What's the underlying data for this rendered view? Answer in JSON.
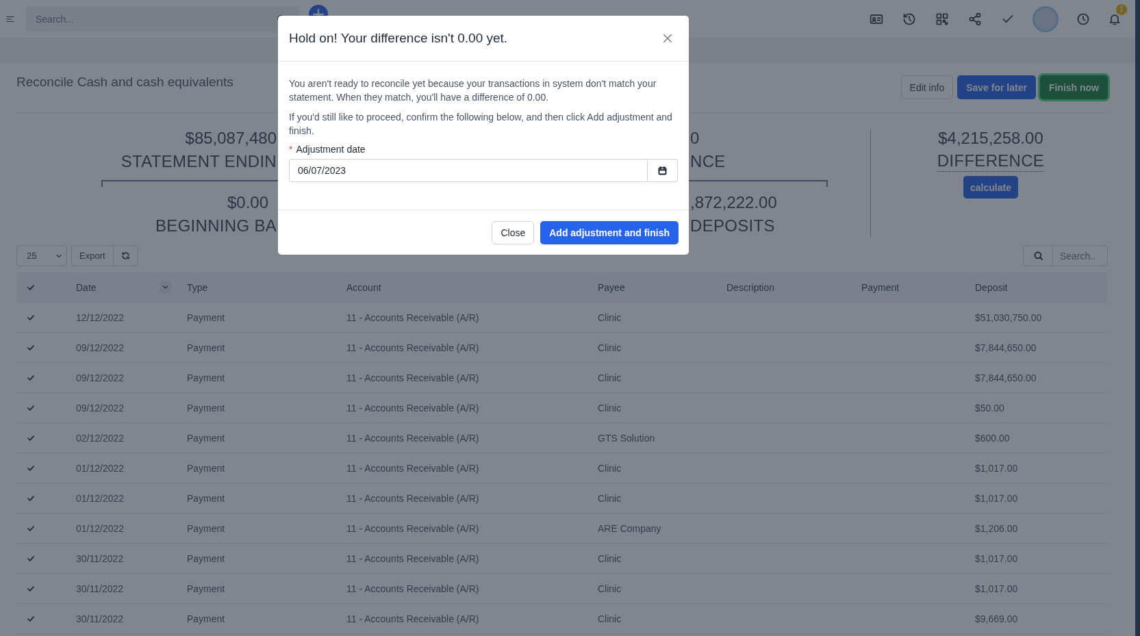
{
  "topbar": {
    "search_placeholder": "Search...",
    "notification_count": "1"
  },
  "page": {
    "title": "Reconcile Cash and cash equivalents",
    "actions": [
      {
        "label": "Edit info",
        "kind": "outline",
        "focused": false
      },
      {
        "label": "Save for later",
        "kind": "primary",
        "focused": false
      },
      {
        "label": "Finish now",
        "kind": "success",
        "focused": true
      }
    ]
  },
  "summary": {
    "left": [
      {
        "amount": "$85,087,480",
        "label": "STATEMENT ENDIN"
      },
      {
        "amount": "$0.00",
        "label": "BEGINNING BA"
      }
    ],
    "middle": [
      {
        "amount": "0",
        "label": "NCE"
      },
      {
        "amount": ",872,222.00",
        "label": "DEPOSITS"
      }
    ],
    "difference": {
      "amount": "$4,215,258.00",
      "label": "DIFFERENCE",
      "button": "calculate"
    }
  },
  "toolbar": {
    "page_size": "25",
    "export": "Export",
    "search_placeholder": "Search.."
  },
  "table": {
    "all_checked": true,
    "columns": [
      "Date",
      "Type",
      "Account",
      "Payee",
      "Description",
      "Payment",
      "Deposit"
    ],
    "rows": [
      {
        "checked": true,
        "date": "12/12/2022",
        "type": "Payment",
        "account": "11 - Accounts Receivable (A/R)",
        "payee": "Clinic",
        "description": "",
        "payment": "",
        "deposit": "$51,030,750.00"
      },
      {
        "checked": true,
        "date": "09/12/2022",
        "type": "Payment",
        "account": "11 - Accounts Receivable (A/R)",
        "payee": "Clinic",
        "description": "",
        "payment": "",
        "deposit": "$7,844,650.00"
      },
      {
        "checked": true,
        "date": "09/12/2022",
        "type": "Payment",
        "account": "11 - Accounts Receivable (A/R)",
        "payee": "Clinic",
        "description": "",
        "payment": "",
        "deposit": "$7,844,650.00"
      },
      {
        "checked": true,
        "date": "09/12/2022",
        "type": "Payment",
        "account": "11 - Accounts Receivable (A/R)",
        "payee": "Clinic",
        "description": "",
        "payment": "",
        "deposit": "$50.00"
      },
      {
        "checked": true,
        "date": "02/12/2022",
        "type": "Payment",
        "account": "11 - Accounts Receivable (A/R)",
        "payee": "GTS Solution",
        "description": "",
        "payment": "",
        "deposit": "$600.00"
      },
      {
        "checked": true,
        "date": "01/12/2022",
        "type": "Payment",
        "account": "11 - Accounts Receivable (A/R)",
        "payee": "Clinic",
        "description": "",
        "payment": "",
        "deposit": "$1,017.00"
      },
      {
        "checked": true,
        "date": "01/12/2022",
        "type": "Payment",
        "account": "11 - Accounts Receivable (A/R)",
        "payee": "Clinic",
        "description": "",
        "payment": "",
        "deposit": "$1,017.00"
      },
      {
        "checked": true,
        "date": "01/12/2022",
        "type": "Payment",
        "account": "11 - Accounts Receivable (A/R)",
        "payee": "ARE Company",
        "description": "",
        "payment": "",
        "deposit": "$1,206.00"
      },
      {
        "checked": true,
        "date": "30/11/2022",
        "type": "Payment",
        "account": "11 - Accounts Receivable (A/R)",
        "payee": "Clinic",
        "description": "",
        "payment": "",
        "deposit": "$1,017.00"
      },
      {
        "checked": true,
        "date": "30/11/2022",
        "type": "Payment",
        "account": "11 - Accounts Receivable (A/R)",
        "payee": "Clinic",
        "description": "",
        "payment": "",
        "deposit": "$1,017.00"
      },
      {
        "checked": true,
        "date": "30/11/2022",
        "type": "Payment",
        "account": "11 - Accounts Receivable (A/R)",
        "payee": "Clinic",
        "description": "",
        "payment": "",
        "deposit": "$9,669.00"
      }
    ]
  },
  "modal": {
    "title": "Hold on! Your difference isn't 0.00 yet.",
    "paragraphs": [
      "You aren't ready to reconcile yet because your transactions in system don't match your statement. When they match, you'll have a difference of 0.00.",
      "If you'd still like to proceed, confirm the following below, and then click Add adjustment and finish."
    ],
    "field": {
      "required_mark": "*",
      "label": "Adjustment date",
      "value": "06/07/2023"
    },
    "buttons": [
      {
        "label": "Close",
        "kind": "secondary"
      },
      {
        "label": "Add adjustment and finish",
        "kind": "primary"
      }
    ]
  }
}
